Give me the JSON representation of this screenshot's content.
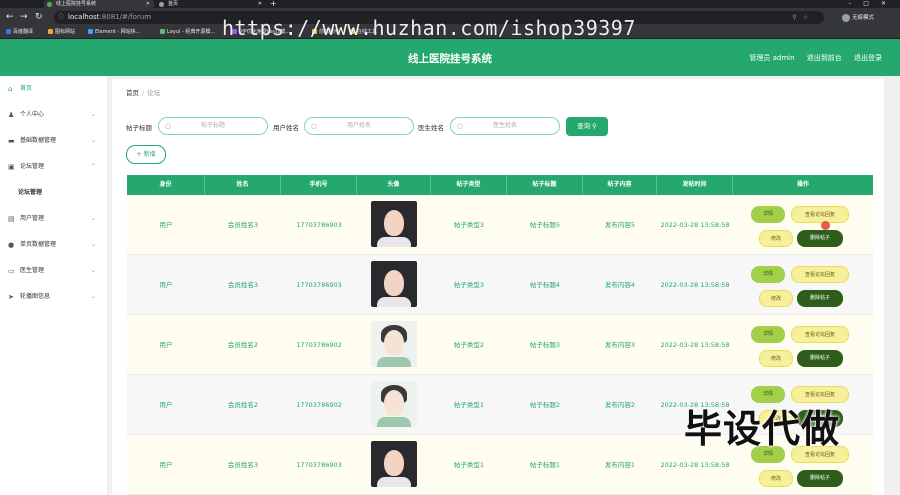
{
  "browser": {
    "tabs": [
      {
        "label": "线上医院挂号系统"
      },
      {
        "label": "首页"
      }
    ],
    "url": "localhost",
    "url_path": ":8081/#/forum",
    "profile_label": "无痕模式",
    "bookmarks": [
      "百度翻译",
      "图标网站",
      "Element - 网站快...",
      "Layui - 经典开源模...",
      "VIP优化免费Layui模...",
      "前端常用",
      "在线工具"
    ]
  },
  "watermark": "https://www.huzhan.com/ishop39397",
  "stamp": "毕设代做",
  "header": {
    "title": "线上医院挂号系统",
    "admin_label": "管理员 admin",
    "back_label": "退出到前台",
    "logout_label": "退出登录"
  },
  "sidebar": {
    "items": [
      {
        "label": "首页",
        "icon": "home-icon"
      },
      {
        "label": "个人中心",
        "icon": "user-icon"
      },
      {
        "label": "基础数据管理",
        "icon": "database-icon"
      },
      {
        "label": "论坛管理",
        "icon": "forum-icon"
      },
      {
        "label": "论坛管理",
        "icon": ""
      },
      {
        "label": "用户管理",
        "icon": "users-icon"
      },
      {
        "label": "单页数据管理",
        "icon": "location-icon"
      },
      {
        "label": "医生管理",
        "icon": "doctor-icon"
      },
      {
        "label": "轮播图信息",
        "icon": "send-icon"
      }
    ]
  },
  "breadcrumb": {
    "home": "首页",
    "sep": "/",
    "current": "论坛"
  },
  "search": {
    "title_label": "帖子标题",
    "title_placeholder": "帖子标题",
    "user_label": "用户姓名",
    "user_placeholder": "用户姓名",
    "doctor_label": "医生姓名",
    "doctor_placeholder": "医生姓名",
    "button_label": "查询"
  },
  "add_button": "+ 新增",
  "table": {
    "headers": [
      "身份",
      "姓名",
      "手机号",
      "头像",
      "帖子类型",
      "帖子标题",
      "帖子内容",
      "发帖时间",
      "操作"
    ],
    "rows": [
      {
        "role": "用户",
        "name": "会员姓名3",
        "phone": "17703786903",
        "type": "帖子类型3",
        "title": "帖子标题5",
        "content": "发布内容5",
        "time": "2022-03-28 13:58:58",
        "avatar": "dark"
      },
      {
        "role": "用户",
        "name": "会员姓名3",
        "phone": "17703786903",
        "type": "帖子类型3",
        "title": "帖子标题4",
        "content": "发布内容4",
        "time": "2022-03-28 13:58:58",
        "avatar": "dark"
      },
      {
        "role": "用户",
        "name": "会员姓名2",
        "phone": "17703786902",
        "type": "帖子类型2",
        "title": "帖子标题3",
        "content": "发布内容3",
        "time": "2022-03-28 13:58:58",
        "avatar": "light"
      },
      {
        "role": "用户",
        "name": "会员姓名2",
        "phone": "17703786902",
        "type": "帖子类型1",
        "title": "帖子标题2",
        "content": "发布内容2",
        "time": "2022-03-28 13:58:58",
        "avatar": "light"
      },
      {
        "role": "用户",
        "name": "会员姓名3",
        "phone": "17703786903",
        "type": "帖子类型1",
        "title": "帖子标题1",
        "content": "发布内容1",
        "time": "2022-03-28 13:58:58",
        "avatar": "dark"
      }
    ],
    "actions": {
      "detail": "详情",
      "view_replies": "查看论坛回复",
      "edit": "修改",
      "delete": "删除帖子"
    }
  },
  "colors": {
    "primary": "#25a86d",
    "header": "#25a86d"
  }
}
